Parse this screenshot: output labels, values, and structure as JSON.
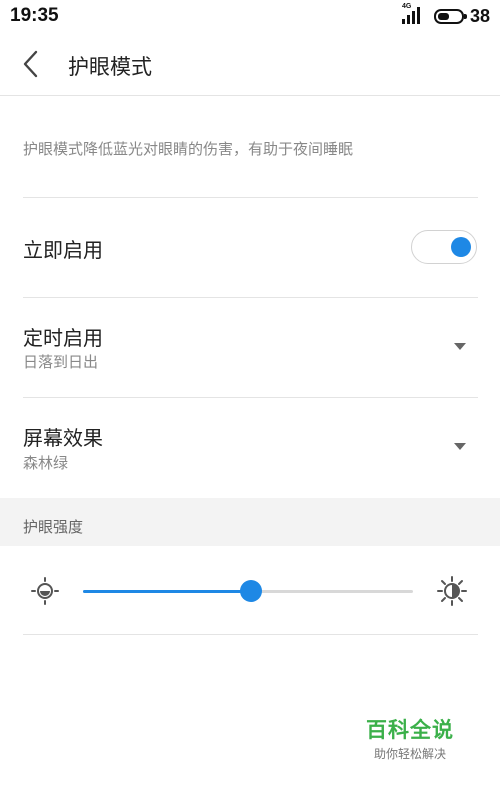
{
  "status_bar": {
    "time": "19:35",
    "network": "4G",
    "battery_level": "38"
  },
  "header": {
    "title": "护眼模式"
  },
  "description": "护眼模式降低蓝光对眼睛的伤害，有助于夜间睡眠",
  "settings": {
    "enable_now": {
      "label": "立即启用",
      "enabled": true
    },
    "schedule": {
      "label": "定时启用",
      "value": "日落到日出"
    },
    "screen_effect": {
      "label": "屏幕效果",
      "value": "森林绿"
    }
  },
  "intensity": {
    "section_label": "护眼强度",
    "level": 0.51
  },
  "watermark": {
    "main": "百科全说",
    "sub": "助你轻松解决"
  },
  "colors": {
    "accent": "#1e88e5",
    "watermark": "#3bb04a"
  },
  "icons": {
    "back": "chevron-left-icon",
    "low": "brightness-low-icon",
    "high": "brightness-high-icon",
    "dropdown": "triangle-down-icon"
  }
}
